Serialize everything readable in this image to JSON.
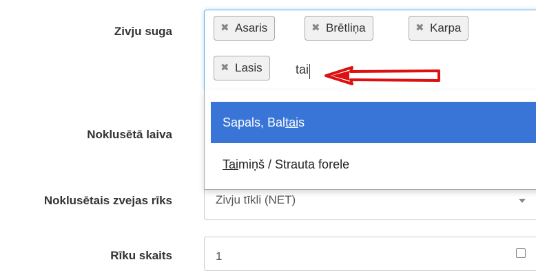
{
  "form": {
    "species_label": "Zivju suga",
    "boat_label": "Noklusētā laiva",
    "gear_label": "Noklusētais zvejas rīks",
    "count_label": "Rīku skaits"
  },
  "species_tags": [
    {
      "label": "Asaris"
    },
    {
      "label": "Brētliņa"
    },
    {
      "label": "Karpa"
    },
    {
      "label": "Lasis"
    }
  ],
  "species_search": {
    "typed": "tai"
  },
  "dropdown_options": [
    {
      "pre": "Sapals, Bal",
      "match": "tai",
      "post": "s",
      "highlighted": true
    },
    {
      "pre": "",
      "match": "Tai",
      "post": "miņš / Strauta forele",
      "highlighted": false
    }
  ],
  "gear": {
    "selected": "Zivju tīkli (NET)"
  },
  "count": {
    "value": "1"
  },
  "annotation": {
    "arrow_color": "#dd1111"
  }
}
